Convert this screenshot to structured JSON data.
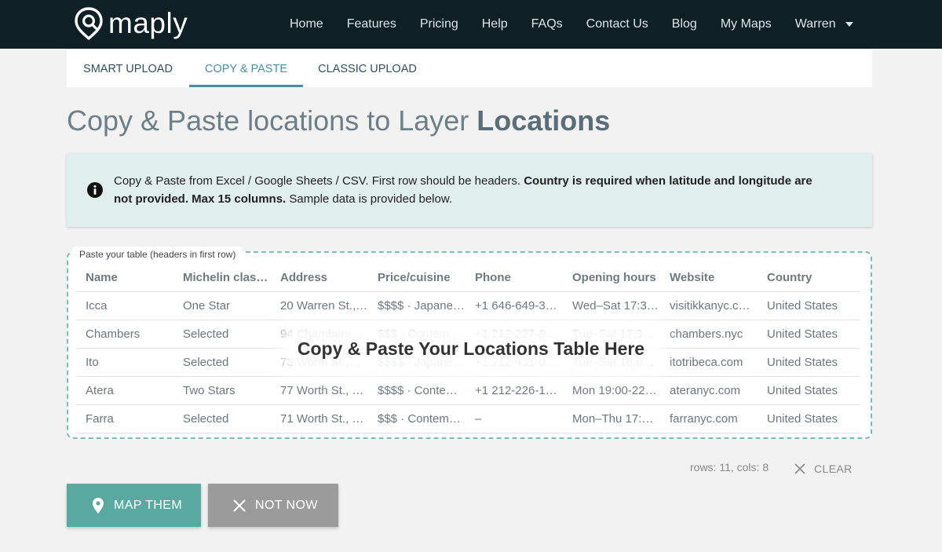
{
  "brand": {
    "name": "maply"
  },
  "nav": {
    "links": [
      "Home",
      "Features",
      "Pricing",
      "Help",
      "FAQs",
      "Contact Us",
      "Blog",
      "My Maps",
      "Warren"
    ]
  },
  "tabs": [
    {
      "label": "SMART UPLOAD",
      "active": false
    },
    {
      "label": "COPY & PASTE",
      "active": true
    },
    {
      "label": "CLASSIC UPLOAD",
      "active": false
    }
  ],
  "page": {
    "title_prefix": "Copy & Paste locations to Layer",
    "title_layer": "Locations"
  },
  "info": {
    "text_normal_1": "Copy & Paste from Excel / Google Sheets / CSV. First row should be headers. ",
    "text_bold": "Country is required when latitude and longitude are not provided. Max 15 columns.",
    "text_normal_2": " Sample data is provided below."
  },
  "paste": {
    "label": "Paste your table (headers in first row)",
    "overlay": "Copy & Paste Your Locations Table Here",
    "headers": [
      "Name",
      "Michelin class…",
      "Address",
      "Price/cuisine",
      "Phone",
      "Opening hours",
      "Website",
      "Country"
    ],
    "rows": [
      [
        "Icca",
        "One Star",
        "20 Warren St.,…",
        "$$$$ · Japane…",
        "+1 646-649-3…",
        "Wed–Sat 17:3…",
        "visitikkanyc.c…",
        "United States"
      ],
      [
        "Chambers",
        "Selected",
        "94 Chambers…",
        "$$$ · Contem…",
        "+1 212-227-8…",
        "Tue–Sat 17:3…",
        "chambers.nyc",
        "United States"
      ],
      [
        "Ito",
        "Selected",
        "73 Worth St.,…",
        "$$$$ · Japane…",
        "+1 212-431-0…",
        "Tue–Sat 18:0…",
        "itotribeca.com",
        "United States"
      ],
      [
        "Atera",
        "Two Stars",
        "77 Worth St., …",
        "$$$$ · Conte…",
        "+1 212-226-1…",
        "Mon 19:00-22…",
        "ateranyc.com",
        "United States"
      ],
      [
        "Farra",
        "Selected",
        "71 Worth St., …",
        "$$$ · Contem…",
        "–",
        "Mon–Thu 17:…",
        "farranyc.com",
        "United States"
      ]
    ]
  },
  "stats": {
    "text": "rows: 11, cols: 8"
  },
  "actions": {
    "clear_label": "CLEAR",
    "map_label": "MAP THEM",
    "not_now_label": "NOT NOW"
  },
  "colors": {
    "navbar": "#0e1f26",
    "accent": "#4c8fa5",
    "map_button": "#5aa9a0",
    "not_now_button": "#9b9b9b",
    "info_background": "#e0eeed"
  },
  "icons": [
    "map-pin-logo-icon",
    "chevron-down-icon",
    "info-icon",
    "close-icon",
    "map-pin-icon"
  ]
}
